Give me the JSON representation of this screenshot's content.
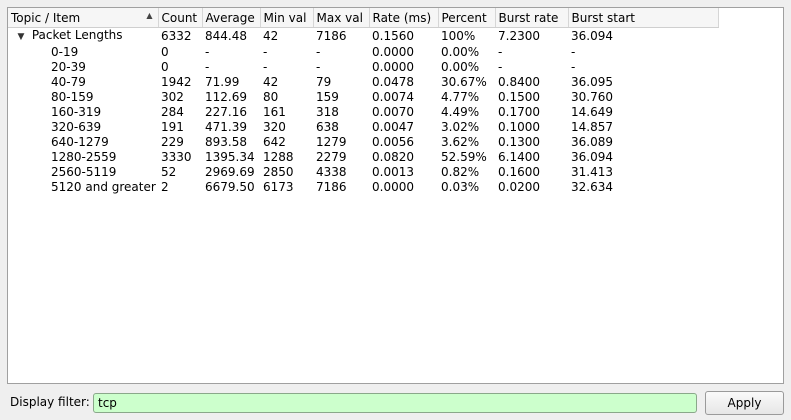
{
  "columns": [
    "Topic / Item",
    "Count",
    "Average",
    "Min val",
    "Max val",
    "Rate (ms)",
    "Percent",
    "Burst rate",
    "Burst start"
  ],
  "rows": [
    {
      "level": 0,
      "expanded": true,
      "cells": [
        "Packet Lengths",
        "6332",
        "844.48",
        "42",
        "7186",
        "0.1560",
        "100%",
        "7.2300",
        "36.094"
      ]
    },
    {
      "level": 1,
      "cells": [
        "0-19",
        "0",
        "-",
        "-",
        "-",
        "0.0000",
        "0.00%",
        "-",
        "-"
      ]
    },
    {
      "level": 1,
      "cells": [
        "20-39",
        "0",
        "-",
        "-",
        "-",
        "0.0000",
        "0.00%",
        "-",
        "-"
      ]
    },
    {
      "level": 1,
      "cells": [
        "40-79",
        "1942",
        "71.99",
        "42",
        "79",
        "0.0478",
        "30.67%",
        "0.8400",
        "36.095"
      ]
    },
    {
      "level": 1,
      "cells": [
        "80-159",
        "302",
        "112.69",
        "80",
        "159",
        "0.0074",
        "4.77%",
        "0.1500",
        "30.760"
      ]
    },
    {
      "level": 1,
      "cells": [
        "160-319",
        "284",
        "227.16",
        "161",
        "318",
        "0.0070",
        "4.49%",
        "0.1700",
        "14.649"
      ]
    },
    {
      "level": 1,
      "cells": [
        "320-639",
        "191",
        "471.39",
        "320",
        "638",
        "0.0047",
        "3.02%",
        "0.1000",
        "14.857"
      ]
    },
    {
      "level": 1,
      "cells": [
        "640-1279",
        "229",
        "893.58",
        "642",
        "1279",
        "0.0056",
        "3.62%",
        "0.1300",
        "36.089"
      ]
    },
    {
      "level": 1,
      "cells": [
        "1280-2559",
        "3330",
        "1395.34",
        "1288",
        "2279",
        "0.0820",
        "52.59%",
        "6.1400",
        "36.094"
      ]
    },
    {
      "level": 1,
      "cells": [
        "2560-5119",
        "52",
        "2969.69",
        "2850",
        "4338",
        "0.0013",
        "0.82%",
        "0.1600",
        "31.413"
      ]
    },
    {
      "level": 1,
      "cells": [
        "5120 and greater",
        "2",
        "6679.50",
        "6173",
        "7186",
        "0.0000",
        "0.03%",
        "0.0200",
        "32.634"
      ]
    }
  ],
  "filter": {
    "label": "Display filter:",
    "value": "tcp",
    "valid_color": "#ccffcc"
  },
  "apply_button": {
    "label": "Apply"
  }
}
